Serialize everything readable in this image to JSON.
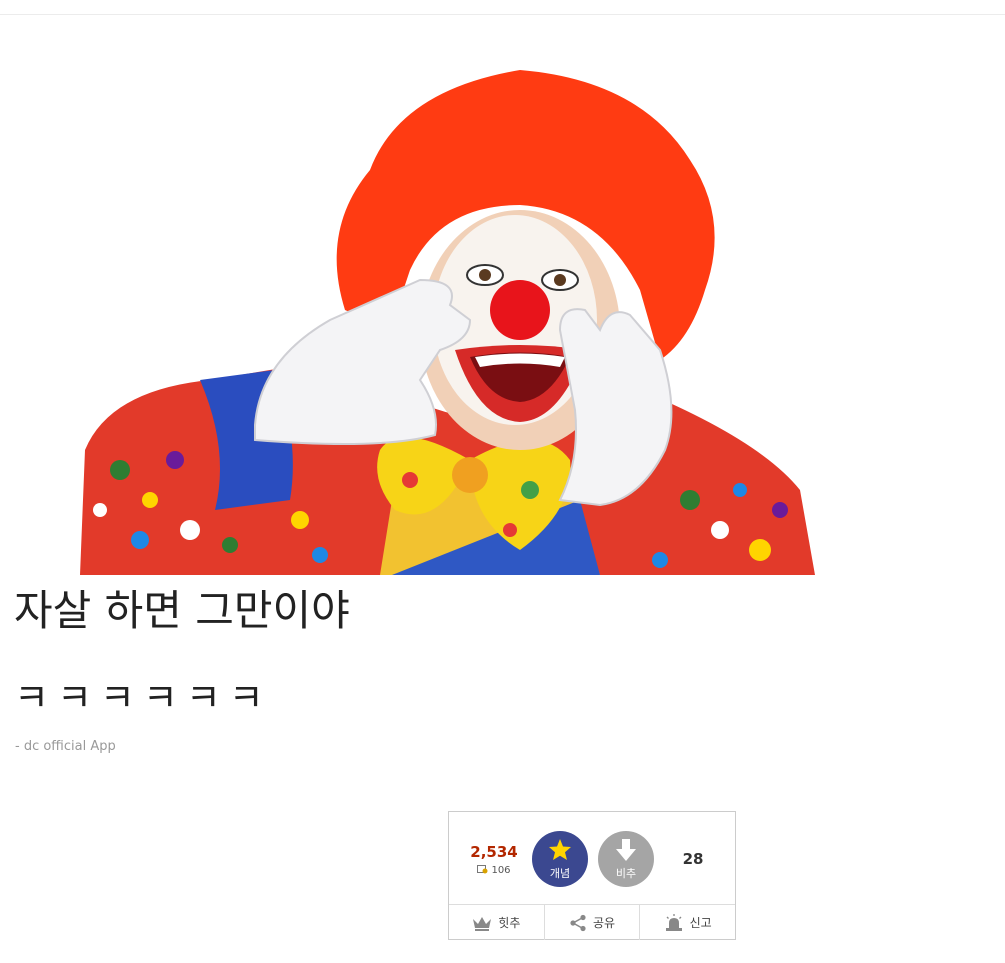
{
  "post": {
    "title": "자살 하면 그만이야",
    "body_text": "ㅋㅋㅋㅋㅋㅋ",
    "signature": "- dc official App"
  },
  "recommend": {
    "up_count": "2,534",
    "fix_count": "106",
    "up_label": "개념",
    "down_label": "비추",
    "down_count": "28",
    "actions": {
      "hit_label": "힛추",
      "share_label": "공유",
      "report_label": "신고"
    }
  },
  "colors": {
    "up_button": "#3b4890",
    "down_button": "#a5a5a5",
    "up_count": "#b32700",
    "star": "#ffd400"
  },
  "icons": [
    "star-icon",
    "arrow-down-icon",
    "crown-icon",
    "share-icon",
    "siren-icon",
    "fix-user-icon"
  ]
}
